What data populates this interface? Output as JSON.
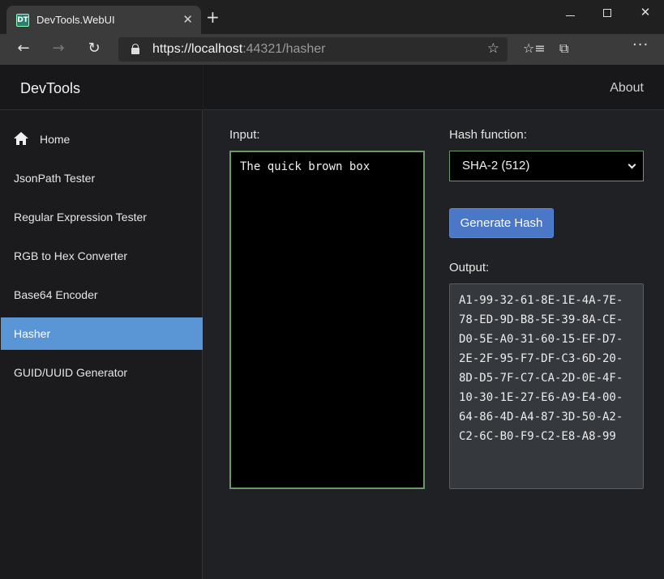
{
  "browser": {
    "tab_title": "DevTools.WebUI",
    "favicon_text": "DT",
    "url_scheme": "https://",
    "url_host": "localhost",
    "url_rest": ":44321/hasher"
  },
  "app": {
    "brand": "DevTools",
    "about": "About"
  },
  "sidebar": {
    "items": [
      {
        "label": "Home",
        "icon": "home-icon"
      },
      {
        "label": "JsonPath Tester"
      },
      {
        "label": "Regular Expression Tester"
      },
      {
        "label": "RGB to Hex Converter"
      },
      {
        "label": "Base64 Encoder"
      },
      {
        "label": "Hasher",
        "active": true
      },
      {
        "label": "GUID/UUID Generator"
      }
    ]
  },
  "hasher": {
    "input_label": "Input:",
    "input_value": "The quick brown box",
    "hash_label": "Hash function:",
    "hash_selected": "SHA-2 (512)",
    "generate_label": "Generate Hash",
    "output_label": "Output:",
    "output_value": "A1-99-32-61-8E-1E-4A-7E-\n78-ED-9D-B8-5E-39-8A-CE-\nD0-5E-A0-31-60-15-EF-D7-\n2E-2F-95-F7-DF-C3-6D-20-\n8D-D5-7F-C7-CA-2D-0E-4F-\n10-30-1E-27-E6-A9-E4-00-\n64-86-4D-A4-87-3D-50-A2-\nC2-6C-B0-F9-C2-E8-A8-99"
  },
  "colors": {
    "accent": "#5a95d6",
    "button": "#4a78c6",
    "focus_border": "#6a9a63"
  }
}
